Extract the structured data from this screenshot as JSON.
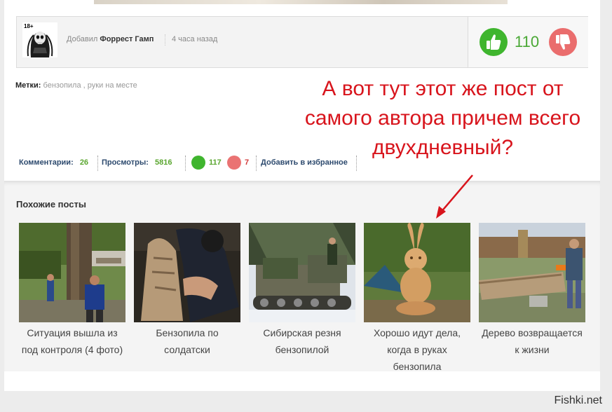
{
  "author": {
    "age_badge": "18+",
    "added_label": "Добавил",
    "name": "Форрест Гамп",
    "time": "4 часа назад"
  },
  "votes": {
    "count": "110"
  },
  "tags": {
    "label": "Метки:",
    "items": [
      "бензопила",
      "руки на месте"
    ],
    "separator": ","
  },
  "annotation": {
    "lines": [
      "А вот тут этот же пост от",
      "самого автора причем всего",
      "двухдневный?"
    ],
    "color": "#d8141c"
  },
  "stats": {
    "comments_label": "Комментарии:",
    "comments_value": "26",
    "views_label": "Просмотры:",
    "views_value": "5816",
    "likes": "117",
    "dislikes": "7",
    "favorite_label": "Добавить в избранное"
  },
  "similar": {
    "title": "Похожие посты",
    "posts": [
      {
        "caption": "Ситуация вышла из под контроля (4 фото)",
        "image": "tree-felling-photo"
      },
      {
        "caption": "Бензопила по солдатски",
        "image": "wood-carving-photo"
      },
      {
        "caption": "Сибирская резня бензопилой",
        "image": "snow-tractor-photo"
      },
      {
        "caption": "Хорошо идут дела, когда в руках бензопила",
        "image": "carved-rabbit-photo"
      },
      {
        "caption": "Дерево возвращается к жизни",
        "image": "fallen-log-photo"
      }
    ]
  },
  "watermark": "Fishki.net",
  "colors": {
    "vote_up": "#3fb52e",
    "vote_down": "#ea6d6d",
    "stat_number": "#5aa62f"
  }
}
